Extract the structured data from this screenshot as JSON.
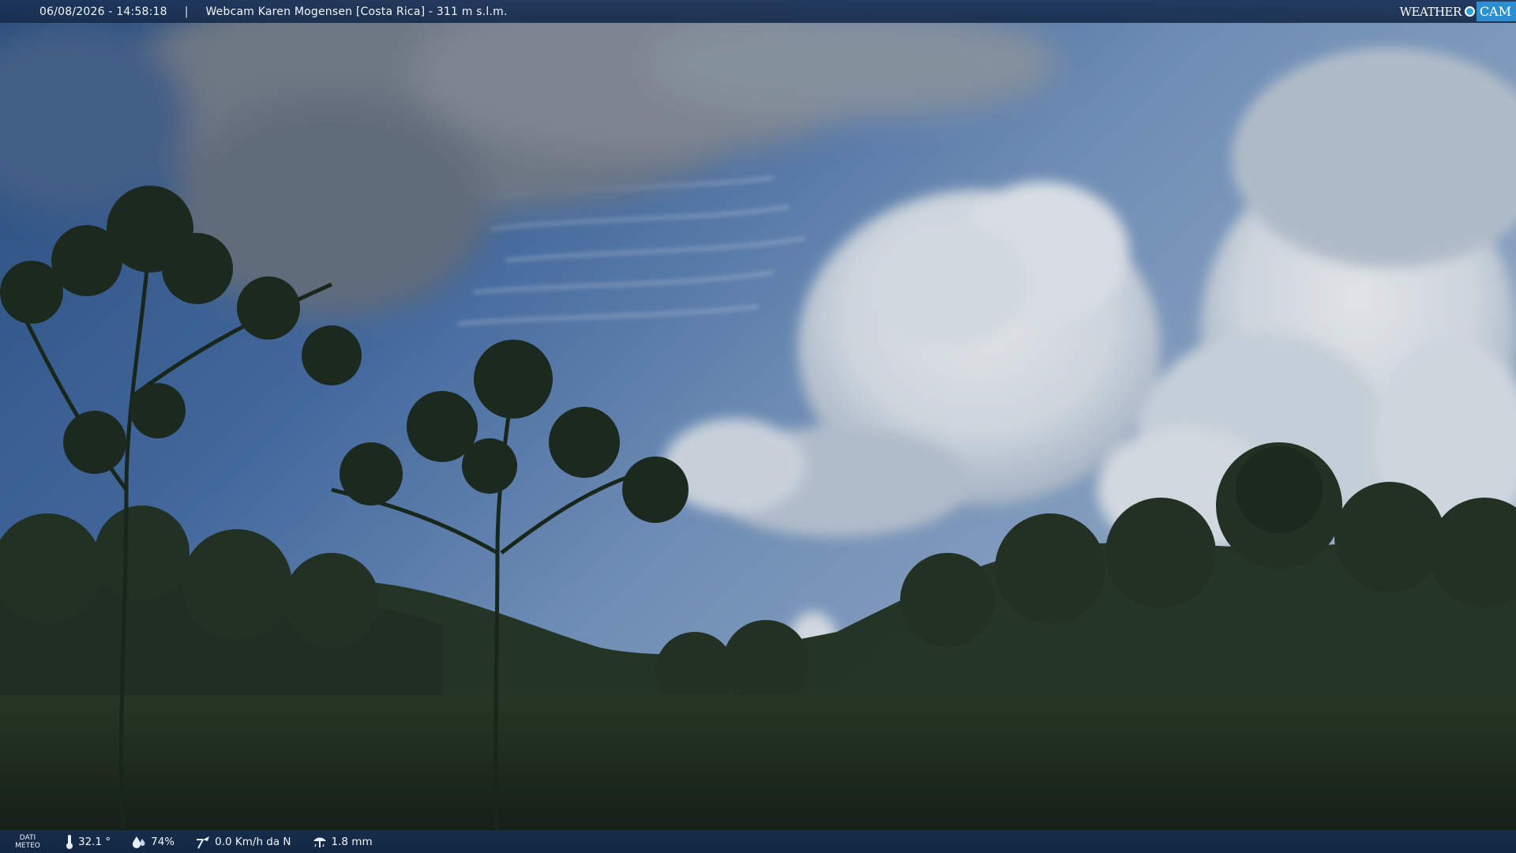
{
  "header": {
    "datetime": "06/08/2026 - 14:58:18",
    "separator": "|",
    "title": "Webcam Karen Mogensen [Costa Rica]  - 311 m s.l.m."
  },
  "logo": {
    "weather": "WEATHER",
    "cam": "CAM"
  },
  "footer": {
    "dati_line1": "DATI",
    "dati_line2": "METEO",
    "temperature": "32.1 °",
    "humidity": "74%",
    "wind": "0.0 Km/h da N",
    "rain": "1.8 mm"
  },
  "icons": {
    "temperature": "thermometer-icon",
    "humidity": "humidity-drop-icon",
    "wind": "wind-vane-icon",
    "rain": "rain-gauge-icon"
  }
}
